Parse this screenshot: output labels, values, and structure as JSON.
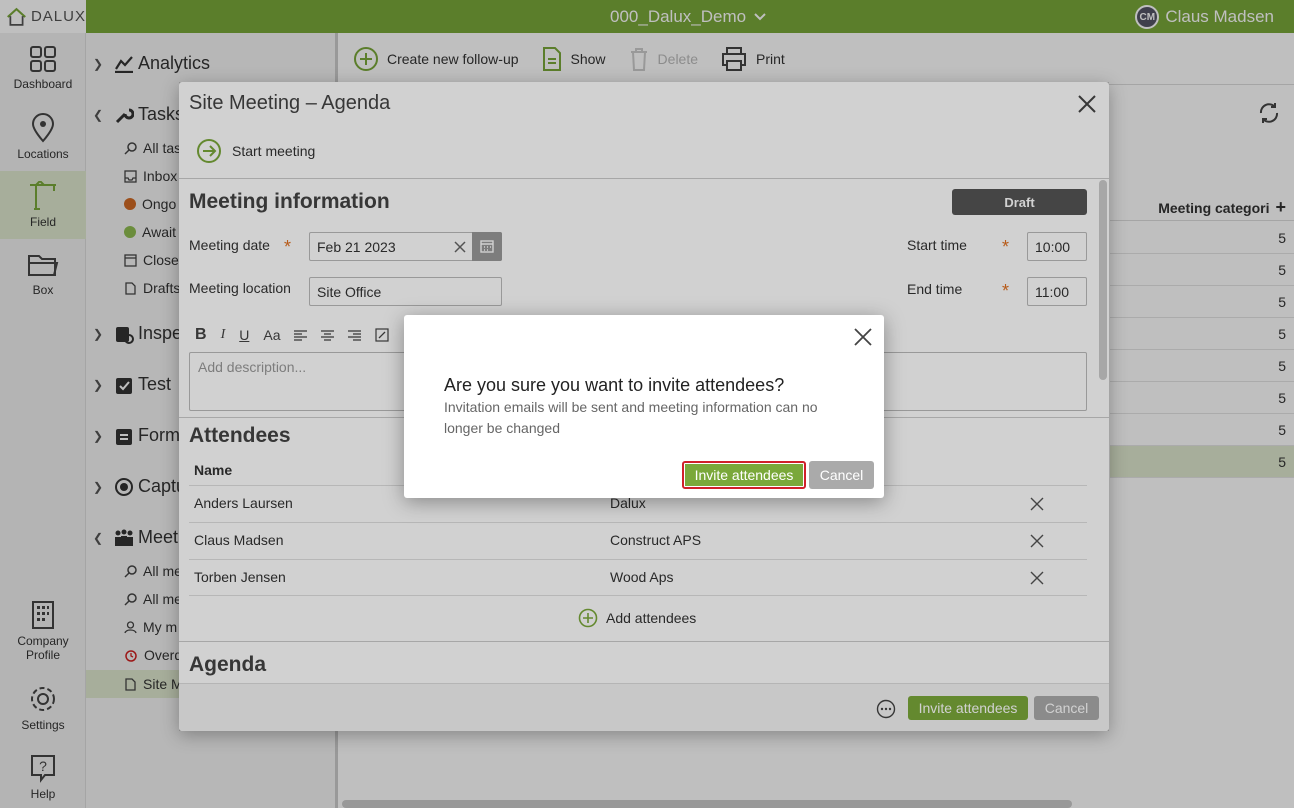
{
  "app": {
    "logo": "DALUX",
    "project": "000_Dalux_Demo",
    "user_initials": "CM",
    "user_name": "Claus Madsen"
  },
  "rail": {
    "dashboard": "Dashboard",
    "locations": "Locations",
    "field": "Field",
    "box": "Box",
    "company_line1": "Company",
    "company_line2": "Profile",
    "settings": "Settings",
    "help": "Help"
  },
  "nav": {
    "analytics": "Analytics",
    "tasks": "Tasks",
    "tasks_items": [
      "All tas",
      "Inbox",
      "Ongo",
      "Await",
      "Close",
      "Drafts"
    ],
    "inspections": "Inspe",
    "test": "Test",
    "forms": "Form",
    "capture": "Captu",
    "meetings": "Meet",
    "meetings_items": [
      "All me",
      "All me",
      "My m",
      "Overd",
      "Site M"
    ]
  },
  "toolbar": {
    "create": "Create new follow-up",
    "show": "Show",
    "delete": "Delete",
    "print": "Print"
  },
  "background_table": {
    "header": "Meeting categori",
    "values": [
      "5",
      "5",
      "5",
      "5",
      "5",
      "5",
      "5",
      "5"
    ]
  },
  "modal": {
    "title": "Site Meeting – Agenda",
    "start_meeting": "Start meeting",
    "meeting_info_title": "Meeting information",
    "status_badge": "Draft",
    "meeting_date_label": "Meeting date",
    "meeting_date_value": "Feb 21 2023",
    "meeting_location_label": "Meeting location",
    "meeting_location_value": "Site Office",
    "start_time_label": "Start time",
    "start_time_value": "10:00",
    "end_time_label": "End time",
    "end_time_value": "11:00",
    "required_mark": "*",
    "rte_bold": "B",
    "rte_italic": "I",
    "rte_underline": "U",
    "rte_fontsize": "Aa",
    "description_placeholder": "Add description...",
    "attendees_title": "Attendees",
    "attendees_name_header": "Name",
    "attendees": [
      {
        "name": "Anders Laursen",
        "company": "Dalux"
      },
      {
        "name": "Claus Madsen",
        "company": "Construct APS"
      },
      {
        "name": "Torben Jensen",
        "company": "Wood Aps"
      }
    ],
    "add_attendees": "Add attendees",
    "agenda_title": "Agenda",
    "footer_invite": "Invite attendees",
    "footer_cancel": "Cancel"
  },
  "dialog": {
    "title": "Are you sure you want to invite attendees?",
    "body": "Invitation emails will be sent and meeting information can no longer be changed",
    "invite": "Invite attendees",
    "cancel": "Cancel"
  },
  "colors": {
    "brand_green": "#7aa83a",
    "draft_badge": "#555555",
    "required": "#e07020",
    "highlight_border": "#d0202a"
  }
}
